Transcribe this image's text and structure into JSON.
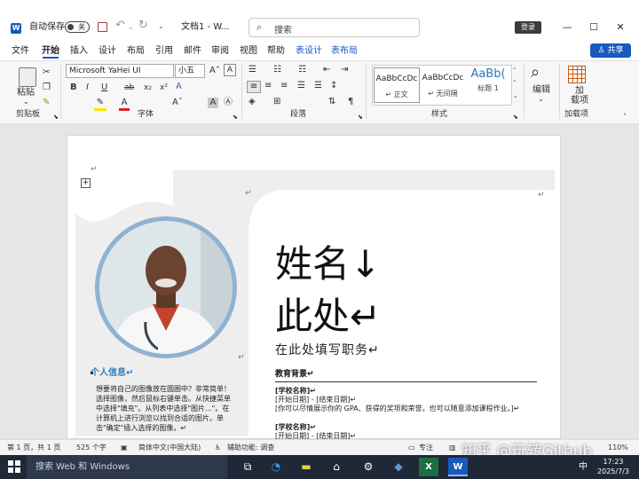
{
  "titlebar": {
    "autosave_label": "自动保存",
    "autosave_state": "关",
    "doc_title": "文档1 - W...",
    "search_placeholder": "搜索",
    "login_label": "登录",
    "minimize": "—",
    "maximize": "☐",
    "close": "✕"
  },
  "menu": {
    "items": [
      "文件",
      "开始",
      "插入",
      "设计",
      "布局",
      "引用",
      "邮件",
      "审阅",
      "视图",
      "帮助",
      "表设计",
      "表布局"
    ],
    "active": "开始",
    "share_label": "♙ 共享"
  },
  "ribbon": {
    "paste_label": "粘贴",
    "font_name": "Microsoft YaHei UI",
    "font_size": "小五",
    "styles": [
      {
        "preview": "AaBbCcDc",
        "name": "↵ 正文"
      },
      {
        "preview": "AaBbCcDc",
        "name": "↵ 无间隔"
      },
      {
        "preview": "AaBb(",
        "name": "标题 1"
      }
    ],
    "edit_label": "编辑",
    "addin_label": "加\n载项",
    "groups": {
      "clipboard": "剪贴板",
      "font": "字体",
      "paragraph": "段落",
      "styles": "样式",
      "addins": "加载项"
    }
  },
  "document": {
    "name_line1": "姓名↓",
    "name_line2": "此处↵",
    "job_title": "在此处填写职务↵",
    "education_heading": "教育背景↵",
    "edu_entries": [
      {
        "school": "[学校名称]↵",
        "dates": "[开始日期] - [结束日期]↵",
        "note": "[你可以尽情展示你的 GPA、获得的奖项和荣誉。也可以随意添加课程作业。]↵"
      },
      {
        "school": "[学校名称]↵",
        "dates": "[开始日期] - [结束日期]↵"
      }
    ],
    "info_heading": "个人信息↵",
    "info_body": "想要将自己的图像放在圆圈中？非常简单！选择图像，然后鼠标右键单击。从快捷菜单中选择\"填充\"。从列表中选择\"图片...\"。在计算机上进行浏览以找到合适的图片。单击\"确定\"插入选择的图像。↵"
  },
  "statusbar": {
    "page": "第 1 页，共 1 页",
    "words": "525 个字",
    "language": "简体中文(中国大陆)",
    "accessibility": "辅助功能: 调查",
    "focus": "专注",
    "zoom": "110%"
  },
  "taskbar": {
    "search_placeholder": "搜索 Web 和 Windows",
    "time": "17:23",
    "date": "2025/7/3",
    "ime": "中"
  },
  "watermark": "知乎 @玩转Github",
  "colors": {
    "accent": "#185abd",
    "photo_ring": "#8fb2d3",
    "info_heading": "#2e7dbf"
  }
}
